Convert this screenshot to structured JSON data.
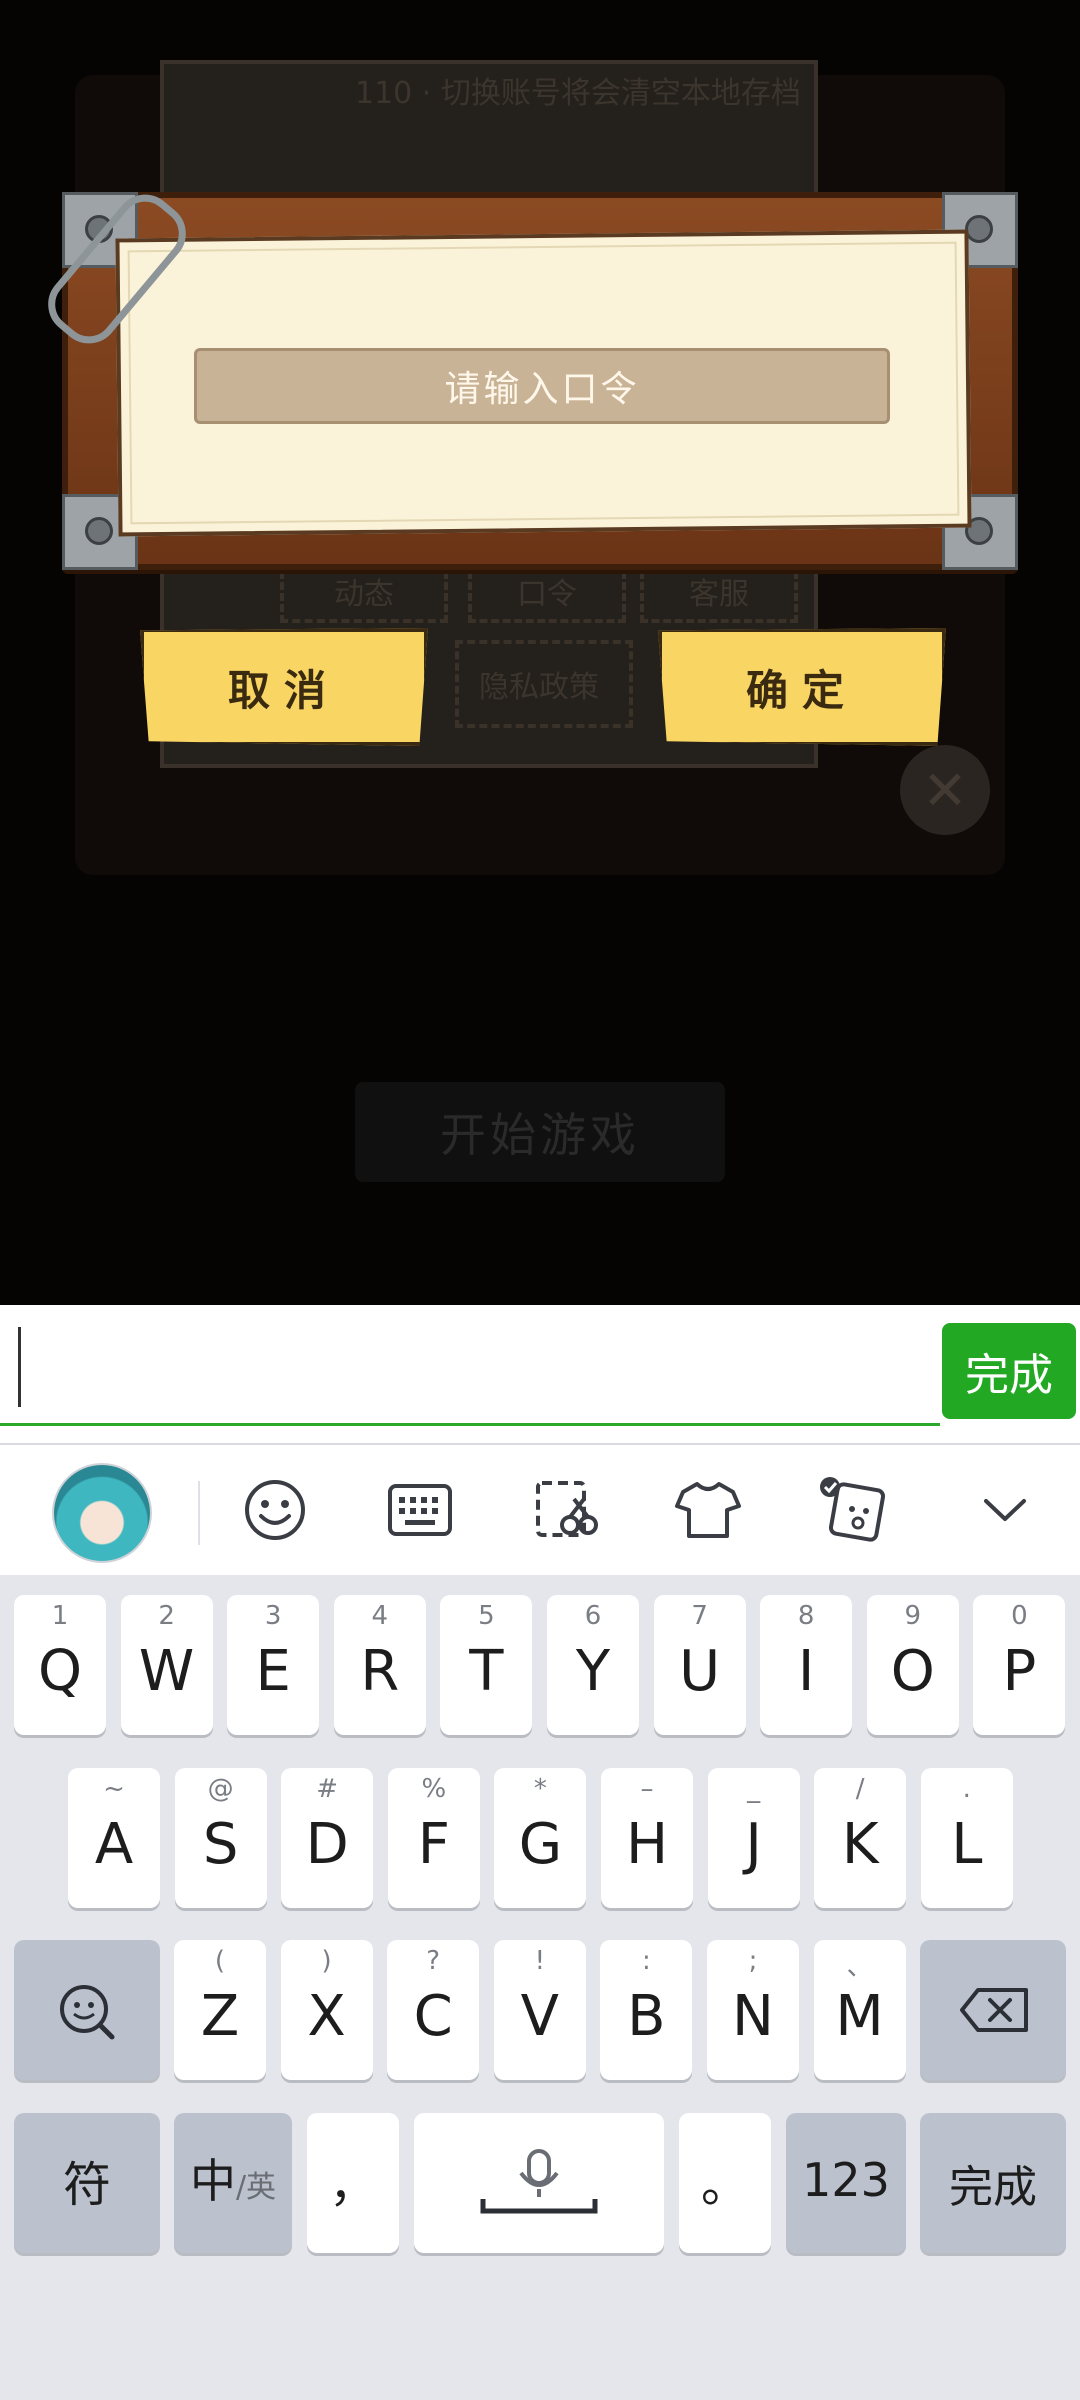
{
  "game": {
    "background_hint_text": "110 · 切换账号将会清空本地存档",
    "dim_labels": [
      "动态",
      "口令",
      "客服",
      "隐私政策"
    ],
    "start_button_label": "开始游戏",
    "dialog": {
      "placeholder": "请输入口令",
      "cancel_label": "取消",
      "confirm_label": "确定"
    }
  },
  "input_bar": {
    "value": "",
    "done_label": "完成",
    "accent_color": "#23a823"
  },
  "keyboard": {
    "toolbar": [
      {
        "name": "avatar-icon"
      },
      {
        "name": "emoji-icon"
      },
      {
        "name": "keyboard-icon"
      },
      {
        "name": "clipboard-edit-icon"
      },
      {
        "name": "skin-tshirt-icon"
      },
      {
        "name": "sticker-icon"
      },
      {
        "name": "collapse-chevron-icon"
      }
    ],
    "row1": [
      {
        "main": "Q",
        "sub": "1"
      },
      {
        "main": "W",
        "sub": "2"
      },
      {
        "main": "E",
        "sub": "3"
      },
      {
        "main": "R",
        "sub": "4"
      },
      {
        "main": "T",
        "sub": "5"
      },
      {
        "main": "Y",
        "sub": "6"
      },
      {
        "main": "U",
        "sub": "7"
      },
      {
        "main": "I",
        "sub": "8"
      },
      {
        "main": "O",
        "sub": "9"
      },
      {
        "main": "P",
        "sub": "0"
      }
    ],
    "row2": [
      {
        "main": "A",
        "sub": "~"
      },
      {
        "main": "S",
        "sub": "@"
      },
      {
        "main": "D",
        "sub": "#"
      },
      {
        "main": "F",
        "sub": "%"
      },
      {
        "main": "G",
        "sub": "*"
      },
      {
        "main": "H",
        "sub": "–"
      },
      {
        "main": "J",
        "sub": "_"
      },
      {
        "main": "K",
        "sub": "/"
      },
      {
        "main": "L",
        "sub": "."
      }
    ],
    "row3": [
      {
        "main": "Z",
        "sub": "("
      },
      {
        "main": "X",
        "sub": ")"
      },
      {
        "main": "C",
        "sub": "?"
      },
      {
        "main": "V",
        "sub": "!"
      },
      {
        "main": "B",
        "sub": ":"
      },
      {
        "main": "N",
        "sub": ";"
      },
      {
        "main": "M",
        "sub": "、"
      }
    ],
    "symbols_label": "符",
    "lang_label": "中",
    "lang_sub_label": "/英",
    "comma_label": "，",
    "period_label": "。",
    "numbers_label": "123",
    "done_label": "完成"
  }
}
